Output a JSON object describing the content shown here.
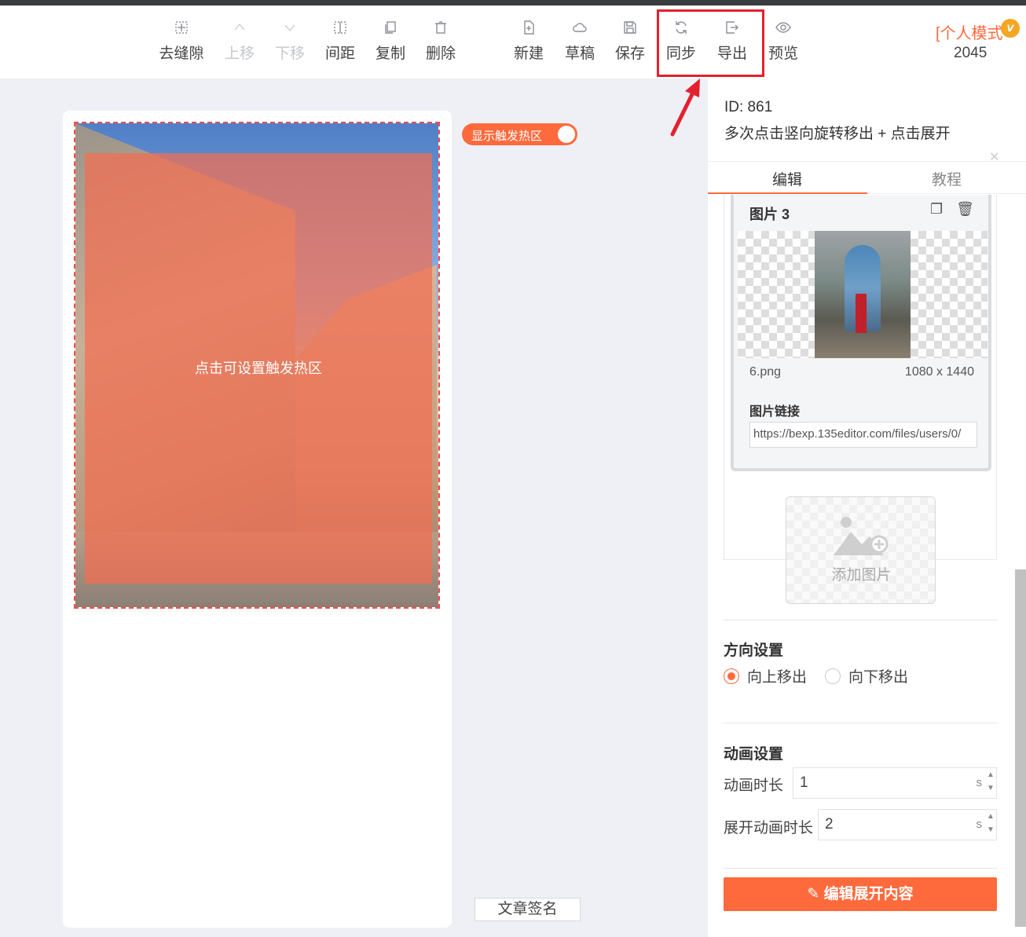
{
  "toolbar": {
    "items": [
      {
        "label": "去缝隙",
        "icon": "grid-dashed-icon",
        "disabled": false
      },
      {
        "label": "上移",
        "icon": "chevron-up-icon",
        "disabled": true
      },
      {
        "label": "下移",
        "icon": "chevron-down-icon",
        "disabled": true
      },
      {
        "label": "间距",
        "icon": "spacing-icon",
        "disabled": false
      },
      {
        "label": "复制",
        "icon": "copy-icon",
        "disabled": false
      },
      {
        "label": "删除",
        "icon": "trash-icon",
        "disabled": false
      },
      {
        "label": "新建",
        "icon": "new-file-icon",
        "disabled": false
      },
      {
        "label": "草稿",
        "icon": "cloud-icon",
        "disabled": false
      },
      {
        "label": "保存",
        "icon": "save-icon",
        "disabled": false
      },
      {
        "label": "同步",
        "icon": "sync-icon",
        "disabled": false
      },
      {
        "label": "导出",
        "icon": "export-icon",
        "disabled": false
      },
      {
        "label": "预览",
        "icon": "eye-icon",
        "disabled": false
      }
    ],
    "mode_label": "[个人模式",
    "mode_badge": "v",
    "mode_count": "2045"
  },
  "canvas": {
    "hotzone_toggle_label": "显示触发热区",
    "hotzone_toggle_on": true,
    "hotzone_label": "点击可设置触发热区",
    "signature_button": "文章签名"
  },
  "panel": {
    "id_text": "ID: 861",
    "description": "多次点击竖向旋转移出 + 点击展开",
    "tabs": [
      {
        "label": "编辑",
        "active": true
      },
      {
        "label": "教程",
        "active": false
      }
    ],
    "image_card": {
      "title": "图片 3",
      "filename": "6.png",
      "dimensions": "1080 x 1440",
      "link_label": "图片链接",
      "link_value": "https://bexp.135editor.com/files/users/0/"
    },
    "add_image_label": "添加图片",
    "direction": {
      "title": "方向设置",
      "options": [
        {
          "label": "向上移出",
          "selected": true
        },
        {
          "label": "向下移出",
          "selected": false
        }
      ]
    },
    "animation": {
      "title": "动画设置",
      "duration_label": "动画时长",
      "duration_value": "1",
      "expand_label": "展开动画时长",
      "expand_value": "2",
      "unit": "s"
    },
    "edit_button": "编辑展开内容"
  },
  "colors": {
    "accent": "#ff6a3d",
    "highlight_box": "#e5202e",
    "mode_badge": "#f5a623"
  }
}
